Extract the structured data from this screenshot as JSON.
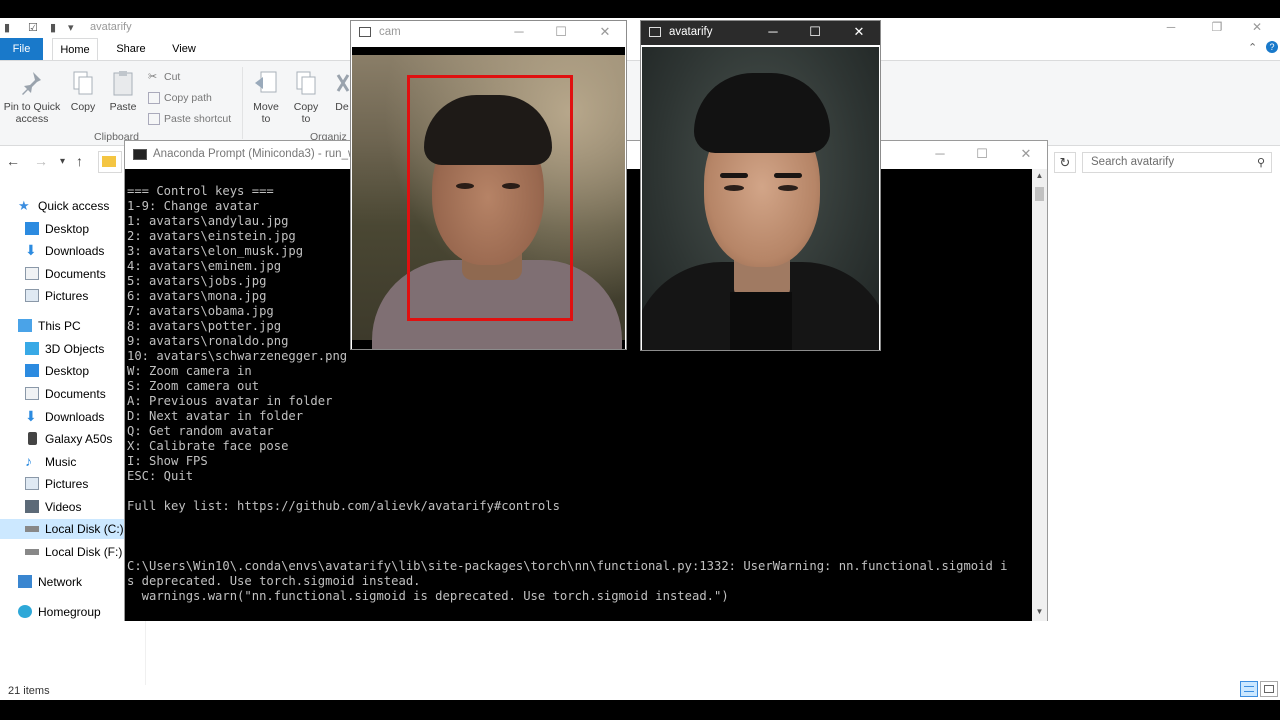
{
  "explorer": {
    "title": "avatarify",
    "ribbon_tabs": [
      "File",
      "Home",
      "Share",
      "View"
    ],
    "clipboard": {
      "pin_label": "Pin to Quick access",
      "copy_label": "Copy",
      "paste_label": "Paste",
      "cut_label": "Cut",
      "copy_path_label": "Copy path",
      "paste_shortcut_label": "Paste shortcut",
      "group_label": "Clipboard"
    },
    "organize": {
      "move_label": "Move to",
      "copy_to_label": "Copy to",
      "delete_label": "De",
      "group_label": "Organiz"
    },
    "search_placeholder": "Search avatarify",
    "nav": {
      "quick_access": "Quick access",
      "quick_items": [
        "Desktop",
        "Downloads",
        "Documents",
        "Pictures"
      ],
      "this_pc": "This PC",
      "pc_items": [
        "3D Objects",
        "Desktop",
        "Documents",
        "Downloads",
        "Galaxy A50s",
        "Music",
        "Pictures",
        "Videos",
        "Local Disk (C:)",
        "Local Disk (F:)"
      ],
      "network": "Network",
      "homegroup": "Homegroup"
    },
    "status": "21 items"
  },
  "prompt": {
    "title": "Anaconda Prompt (Miniconda3) - run_w",
    "lines": [
      "=== Control keys ===",
      "1-9: Change avatar",
      "1: avatars\\andylau.jpg",
      "2: avatars\\einstein.jpg",
      "3: avatars\\elon_musk.jpg",
      "4: avatars\\eminem.jpg",
      "5: avatars\\jobs.jpg",
      "6: avatars\\mona.jpg",
      "7: avatars\\obama.jpg",
      "8: avatars\\potter.jpg",
      "9: avatars\\ronaldo.png",
      "10: avatars\\schwarzenegger.png",
      "W: Zoom camera in",
      "S: Zoom camera out",
      "A: Previous avatar in folder",
      "D: Next avatar in folder",
      "Q: Get random avatar",
      "X: Calibrate face pose",
      "I: Show FPS",
      "ESC: Quit",
      "",
      "Full key list: https://github.com/alievk/avatarify#controls",
      "",
      "",
      "",
      "C:\\Users\\Win10\\.conda\\envs\\avatarify\\lib\\site-packages\\torch\\nn\\functional.py:1332: UserWarning: nn.functional.sigmoid i",
      "s deprecated. Use torch.sigmoid instead.",
      "  warnings.warn(\"nn.functional.sigmoid is deprecated. Use torch.sigmoid instead.\")"
    ]
  },
  "cam_window": {
    "title": "cam"
  },
  "avatar_window": {
    "title": "avatarify"
  },
  "colors": {
    "file_tab": "#1979ca",
    "face_box": "#e01010",
    "nav_selected": "#cce8ff",
    "console_bg": "#000000",
    "console_text": "#c0c0c0"
  }
}
